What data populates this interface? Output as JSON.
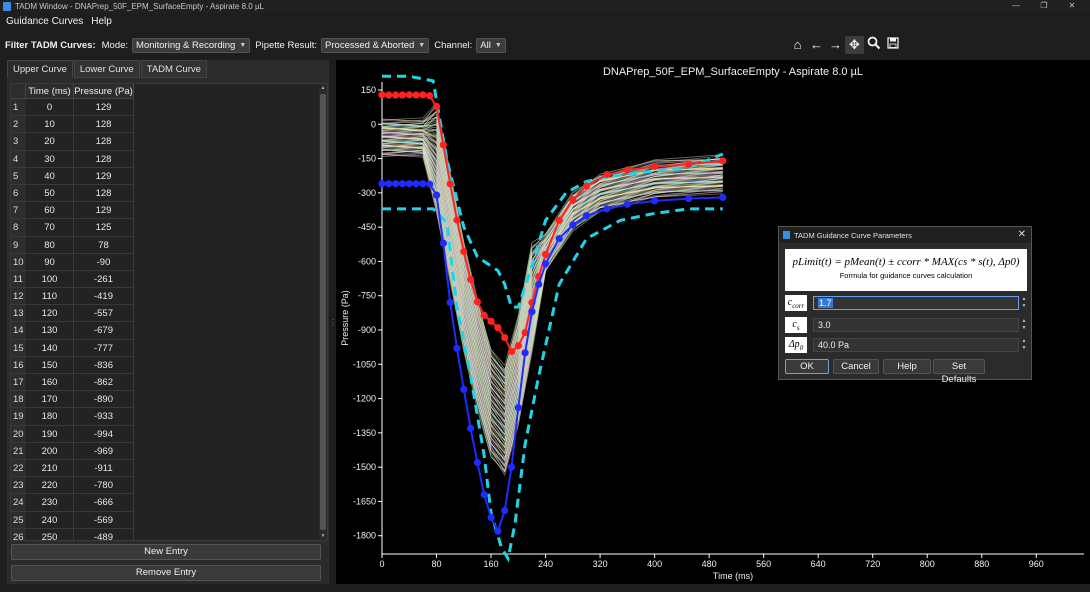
{
  "window": {
    "title": "TADM Window - DNAPrep_50F_EPM_SurfaceEmpty - Aspirate 8.0 µL"
  },
  "menu": [
    {
      "label": "Guidance Curves"
    },
    {
      "label": "Help"
    }
  ],
  "filter": {
    "heading": "Filter TADM Curves:",
    "mode_label": "Mode:",
    "mode_value": "Monitoring & Recording",
    "pipette_label": "Pipette Result:",
    "pipette_value": "Processed & Aborted",
    "channel_label": "Channel:",
    "channel_value": "All"
  },
  "toolbar_icons": [
    "home-icon",
    "back-arrow-icon",
    "forward-arrow-icon",
    "pan-icon",
    "zoom-icon",
    "save-icon"
  ],
  "tabs": [
    {
      "label": "Upper Curve"
    },
    {
      "label": "Lower Curve"
    },
    {
      "label": "TADM Curve"
    }
  ],
  "table": {
    "headers": [
      "Time (ms)",
      "Pressure (Pa)"
    ],
    "rows": [
      [
        "1",
        "0",
        "129"
      ],
      [
        "2",
        "10",
        "128"
      ],
      [
        "3",
        "20",
        "128"
      ],
      [
        "4",
        "30",
        "128"
      ],
      [
        "5",
        "40",
        "129"
      ],
      [
        "6",
        "50",
        "128"
      ],
      [
        "7",
        "60",
        "129"
      ],
      [
        "8",
        "70",
        "125"
      ],
      [
        "9",
        "80",
        "78"
      ],
      [
        "10",
        "90",
        "-90"
      ],
      [
        "11",
        "100",
        "-261"
      ],
      [
        "12",
        "110",
        "-419"
      ],
      [
        "13",
        "120",
        "-557"
      ],
      [
        "14",
        "130",
        "-679"
      ],
      [
        "15",
        "140",
        "-777"
      ],
      [
        "16",
        "150",
        "-836"
      ],
      [
        "17",
        "160",
        "-862"
      ],
      [
        "18",
        "170",
        "-890"
      ],
      [
        "19",
        "180",
        "-933"
      ],
      [
        "20",
        "190",
        "-994"
      ],
      [
        "21",
        "200",
        "-969"
      ],
      [
        "22",
        "210",
        "-911"
      ],
      [
        "23",
        "220",
        "-780"
      ],
      [
        "24",
        "230",
        "-666"
      ],
      [
        "25",
        "240",
        "-569"
      ],
      [
        "26",
        "250",
        "-489"
      ]
    ]
  },
  "buttons": {
    "new_entry": "New Entry",
    "remove_entry": "Remove Entry"
  },
  "chart_data": {
    "type": "line",
    "title": "DNAPrep_50F_EPM_SurfaceEmpty - Aspirate 8.0 µL",
    "xlabel": "Time (ms)",
    "ylabel": "Pressure (Pa)",
    "xlim": [
      0,
      1030
    ],
    "ylim": [
      -1880,
      185
    ],
    "x_ticks": [
      "0",
      "80",
      "160",
      "240",
      "320",
      "400",
      "480",
      "560",
      "640",
      "720",
      "800",
      "880",
      "960"
    ],
    "y_ticks": [
      "150",
      "0",
      "-150",
      "-300",
      "-450",
      "-600",
      "-750",
      "-900",
      "-1050",
      "-1200",
      "-1350",
      "-1500",
      "-1650",
      "-1800"
    ],
    "background": "#000000",
    "series": [
      {
        "role": "upper-limit-dashed",
        "color": "#22d3e8",
        "x": [
          0,
          40,
          75,
          95,
          120,
          140,
          160,
          170,
          180,
          190,
          200,
          220,
          240,
          270,
          300,
          350,
          400,
          450,
          500
        ],
        "y": [
          210,
          210,
          190,
          -150,
          -450,
          -580,
          -620,
          -640,
          -700,
          -800,
          -800,
          -620,
          -420,
          -300,
          -250,
          -220,
          -205,
          -190,
          -130
        ]
      },
      {
        "role": "lower-limit-dashed",
        "color": "#22d3e8",
        "x": [
          0,
          40,
          75,
          95,
          110,
          130,
          150,
          160,
          175,
          185,
          195,
          210,
          230,
          260,
          300,
          350,
          400,
          450,
          500
        ],
        "y": [
          -370,
          -370,
          -370,
          -430,
          -800,
          -1100,
          -1450,
          -1700,
          -1850,
          -1900,
          -1750,
          -1400,
          -1100,
          -700,
          -500,
          -420,
          -390,
          -370,
          -370
        ]
      },
      {
        "role": "upper-guidance",
        "color": "#ff2222",
        "x": [
          0,
          10,
          20,
          30,
          40,
          50,
          60,
          70,
          80,
          90,
          100,
          110,
          120,
          130,
          140,
          150,
          160,
          170,
          180,
          190,
          200,
          210,
          220,
          230,
          240,
          260,
          280,
          300,
          330,
          360,
          400,
          450,
          500
        ],
        "y": [
          129,
          128,
          128,
          128,
          129,
          128,
          129,
          125,
          78,
          -90,
          -261,
          -419,
          -557,
          -679,
          -777,
          -836,
          -862,
          -890,
          -933,
          -994,
          -969,
          -911,
          -780,
          -666,
          -569,
          -420,
          -330,
          -270,
          -220,
          -200,
          -185,
          -175,
          -160
        ]
      },
      {
        "role": "lower-guidance",
        "color": "#1f2bff",
        "x": [
          0,
          10,
          20,
          30,
          40,
          50,
          60,
          70,
          80,
          90,
          100,
          110,
          120,
          130,
          140,
          150,
          160,
          170,
          180,
          190,
          200,
          210,
          220,
          230,
          240,
          260,
          280,
          300,
          330,
          360,
          400,
          450,
          500
        ],
        "y": [
          -260,
          -260,
          -260,
          -260,
          -260,
          -260,
          -260,
          -262,
          -310,
          -520,
          -780,
          -980,
          -1160,
          -1330,
          -1480,
          -1620,
          -1720,
          -1780,
          -1690,
          -1500,
          -1240,
          -1000,
          -820,
          -700,
          -610,
          -500,
          -440,
          -400,
          -370,
          -350,
          -335,
          -325,
          -320
        ]
      },
      {
        "role": "mean-recorded-curves",
        "color": "#e8e8a0",
        "x": [
          0,
          60,
          80,
          100,
          120,
          140,
          160,
          180,
          200,
          220,
          240,
          280,
          320,
          400,
          500
        ],
        "y": [
          -60,
          -60,
          -150,
          -450,
          -750,
          -1000,
          -1220,
          -1300,
          -1080,
          -760,
          -560,
          -380,
          -300,
          -240,
          -220
        ]
      }
    ]
  },
  "dialog": {
    "title": "TADM Guidance Curve Parameters",
    "formula": "pLimit(t) = pMean(t) ± ccorr * MAX(cs * s(t), Δp0)",
    "formula_caption": "Formula for guidance curves calculation",
    "params": [
      {
        "symbol": "c corr",
        "value": "1.7"
      },
      {
        "symbol": "c s",
        "value": "3.0"
      },
      {
        "symbol": "Δp0",
        "value": "40.0 Pa"
      }
    ],
    "buttons": {
      "ok": "OK",
      "cancel": "Cancel",
      "help": "Help",
      "defaults": "Set Defaults"
    }
  }
}
